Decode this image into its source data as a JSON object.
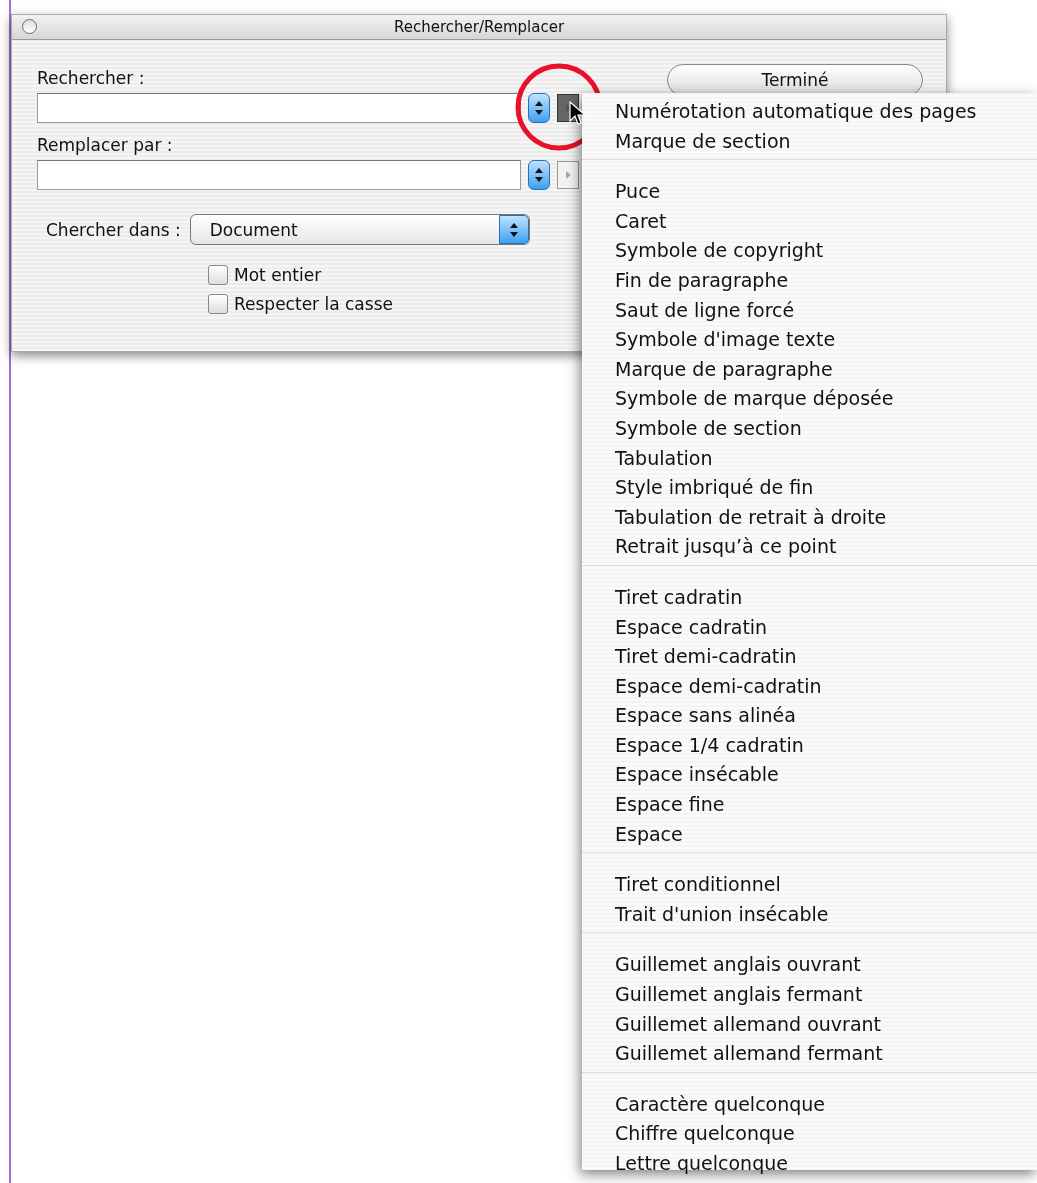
{
  "window": {
    "title": "Rechercher/Remplacer"
  },
  "fields": [
    {
      "label": "Rechercher :",
      "special_pressed": true
    },
    {
      "label": "Remplacer par :",
      "special_pressed": false
    }
  ],
  "search_in": {
    "label": "Chercher dans :",
    "value": "Document"
  },
  "options": [
    {
      "label": "Mot entier",
      "checked": false
    },
    {
      "label": "Respecter la casse",
      "checked": false
    }
  ],
  "buttons": [
    {
      "label": "Terminé"
    }
  ],
  "special_menu": {
    "groups": [
      [
        "Numérotation automatique des pages",
        "Marque de section"
      ],
      [
        "Puce",
        "Caret",
        "Symbole de copyright",
        "Fin de paragraphe",
        "Saut de ligne forcé",
        "Symbole d'image texte",
        "Marque de paragraphe",
        "Symbole de marque déposée",
        "Symbole de section",
        "Tabulation",
        "Style imbriqué de fin",
        "Tabulation de retrait à droite",
        "Retrait jusqu’à ce point"
      ],
      [
        "Tiret cadratin",
        "Espace cadratin",
        "Tiret demi-cadratin",
        "Espace demi-cadratin",
        "Espace sans alinéa",
        "Espace 1/4 cadratin",
        "Espace insécable",
        "Espace fine",
        "Espace"
      ],
      [
        "Tiret conditionnel",
        "Trait d'union insécable"
      ],
      [
        "Guillemet anglais ouvrant",
        "Guillemet anglais fermant",
        "Guillemet allemand ouvrant",
        "Guillemet allemand fermant"
      ],
      [
        "Caractère quelconque",
        "Chiffre quelconque",
        "Lettre quelconque"
      ]
    ]
  }
}
